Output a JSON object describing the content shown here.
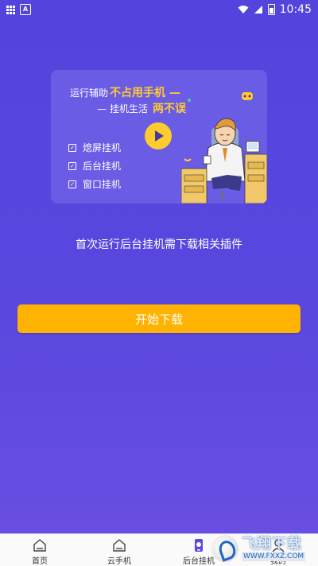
{
  "status_bar": {
    "time": "10:45"
  },
  "banner": {
    "line1_prefix": "运行辅助",
    "line1_highlight": "不占用手机 —",
    "line2_dash": "—",
    "line2_prefix": "挂机生活",
    "line2_highlight": "两不误",
    "features": [
      "熄屏挂机",
      "后台挂机",
      "窗口挂机"
    ],
    "check_glyph": "✓"
  },
  "main": {
    "hint": "首次运行后台挂机需下载相关插件",
    "start_button": "开始下载"
  },
  "bottom_nav": {
    "items": [
      {
        "label": "首页",
        "icon": "home-icon"
      },
      {
        "label": "云手机",
        "icon": "cloud-phone-icon"
      },
      {
        "label": "后台挂机",
        "icon": "background-hangup-icon"
      },
      {
        "label": "我的",
        "icon": "profile-icon"
      }
    ],
    "active_index": 2
  },
  "watermark": {
    "title": "飞翔下载",
    "url": "WWW.FXXZ.COM"
  },
  "colors": {
    "background": "#5447dd",
    "accent": "#ffb300",
    "highlight_text": "#ffcc2e"
  }
}
